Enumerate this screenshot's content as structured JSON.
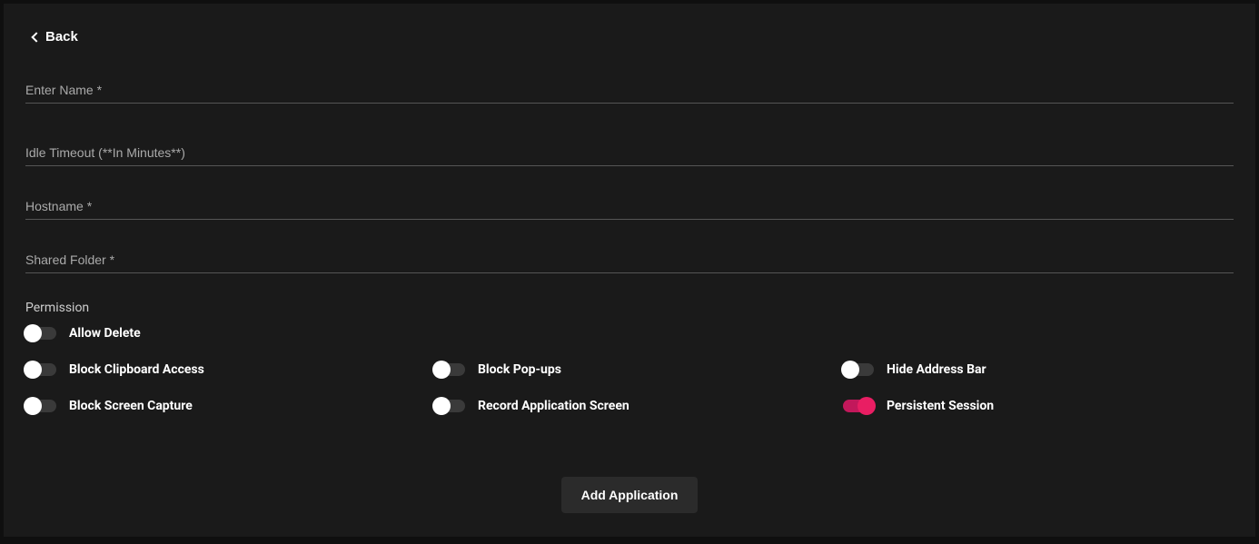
{
  "back": {
    "label": "Back"
  },
  "fields": {
    "name": {
      "placeholder": "Enter Name *"
    },
    "idle": {
      "placeholder": "Idle Timeout (**In Minutes**)"
    },
    "hostname": {
      "placeholder": "Hostname *"
    },
    "shared": {
      "placeholder": "Shared Folder *"
    }
  },
  "permission": {
    "heading": "Permission"
  },
  "toggles": {
    "allowDelete": {
      "label": "Allow Delete",
      "on": false
    },
    "blockClipboard": {
      "label": "Block Clipboard Access",
      "on": false
    },
    "blockPopups": {
      "label": "Block Pop-ups",
      "on": false
    },
    "hideAddressBar": {
      "label": "Hide Address Bar",
      "on": false
    },
    "blockScreenCapture": {
      "label": "Block Screen Capture",
      "on": false
    },
    "recordAppScreen": {
      "label": "Record Application Screen",
      "on": false
    },
    "persistentSession": {
      "label": "Persistent Session",
      "on": true
    }
  },
  "actions": {
    "addApp": "Add Application"
  }
}
